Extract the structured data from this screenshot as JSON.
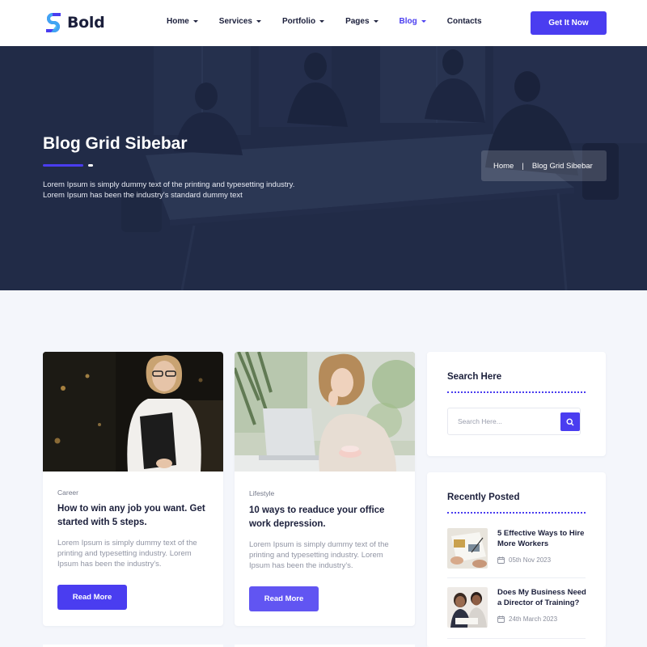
{
  "brand": {
    "name": "Bold",
    "accent": "#4a3df0"
  },
  "nav": {
    "items": [
      {
        "label": "Home",
        "dropdown": true,
        "active": false
      },
      {
        "label": "Services",
        "dropdown": true,
        "active": false
      },
      {
        "label": "Portfolio",
        "dropdown": true,
        "active": false
      },
      {
        "label": "Pages",
        "dropdown": true,
        "active": false
      },
      {
        "label": "Blog",
        "dropdown": true,
        "active": true
      },
      {
        "label": "Contacts",
        "dropdown": false,
        "active": false
      }
    ],
    "cta_label": "Get It Now"
  },
  "hero": {
    "title": "Blog Grid Sibebar",
    "description_line1": "Lorem Ipsum is simply dummy text of the printing and typesetting industry.",
    "description_line2": "Lorem Ipsum has been the industry's standard dummy text",
    "breadcrumb": {
      "home": "Home",
      "separator": "|",
      "current": "Blog Grid Sibebar"
    }
  },
  "posts": [
    {
      "category": "Career",
      "title": "How to win any job you want. Get started with 5 steps.",
      "excerpt": "Lorem Ipsum is simply dummy text of the printing and typesetting industry. Lorem Ipsum has been the industry's.",
      "button": "Read More"
    },
    {
      "category": "Lifestyle",
      "title": "10 ways to readuce your office work depression.",
      "excerpt": "Lorem Ipsum is simply dummy text of the printing and typesetting industry. Lorem Ipsum has been the industry's.",
      "button": "Read More"
    }
  ],
  "sidebar": {
    "search": {
      "title": "Search Here",
      "placeholder": "Search Here..."
    },
    "recent": {
      "title": "Recently Posted",
      "items": [
        {
          "title": "5 Effective Ways to Hire More Workers",
          "date": "05th Nov 2023"
        },
        {
          "title": "Does My Business Need a Director of Training?",
          "date": "24th March 2023"
        }
      ]
    }
  }
}
